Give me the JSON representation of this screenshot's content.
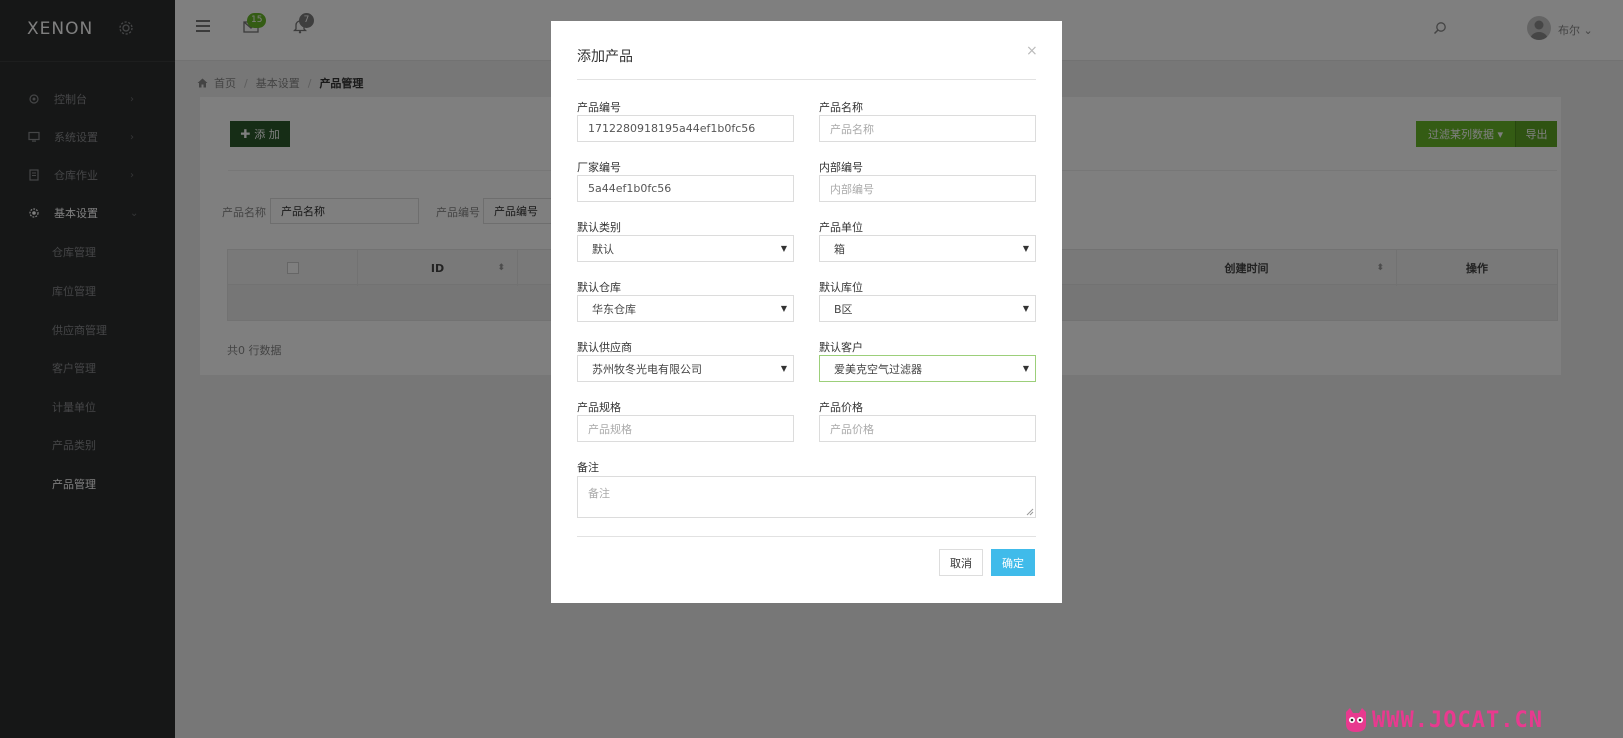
{
  "app": {
    "logo": "XENON"
  },
  "sidebar": {
    "items": [
      {
        "label": "控制台",
        "chevron": "›"
      },
      {
        "label": "系统设置",
        "chevron": "›"
      },
      {
        "label": "仓库作业",
        "chevron": "›"
      },
      {
        "label": "基本设置",
        "chevron": "⌄"
      }
    ],
    "subitems": [
      {
        "label": "仓库管理"
      },
      {
        "label": "库位管理"
      },
      {
        "label": "供应商管理"
      },
      {
        "label": "客户管理"
      },
      {
        "label": "计量单位"
      },
      {
        "label": "产品类别"
      },
      {
        "label": "产品管理"
      }
    ]
  },
  "header": {
    "mail_count": "15",
    "bell_count": "7",
    "user_name": "布尔 ⌄"
  },
  "breadcrumb": {
    "home": "首页",
    "level2": "基本设置",
    "current": "产品管理"
  },
  "panel": {
    "add_label": "添 加",
    "filter_label": "过滤某列数据 ▾",
    "export_label": "导出",
    "filters": {
      "name_label": "产品名称",
      "name_value": "产品名称",
      "code_label": "产品编号",
      "code_value": "产品编号"
    },
    "table": {
      "col_id": "ID",
      "col_created": "创建时间",
      "col_action": "操作",
      "sort_glyph": "⬍"
    },
    "footer": "共0 行数据"
  },
  "modal": {
    "title": "添加产品",
    "close": "×",
    "fields": {
      "product_code": {
        "label": "产品编号",
        "value": "1712280918195a44ef1b0fc56"
      },
      "product_name": {
        "label": "产品名称",
        "placeholder": "产品名称"
      },
      "factory_code": {
        "label": "厂家编号",
        "value": "5a44ef1b0fc56"
      },
      "internal_code": {
        "label": "内部编号",
        "placeholder": "内部编号"
      },
      "default_category": {
        "label": "默认类别",
        "value": "默认"
      },
      "product_unit": {
        "label": "产品单位",
        "value": "箱"
      },
      "default_warehouse": {
        "label": "默认仓库",
        "value": "华东仓库"
      },
      "default_location": {
        "label": "默认库位",
        "value": "B区"
      },
      "default_supplier": {
        "label": "默认供应商",
        "value": "苏州牧冬光电有限公司"
      },
      "default_customer": {
        "label": "默认客户",
        "value": "爱美克空气过滤器"
      },
      "spec": {
        "label": "产品规格",
        "placeholder": "产品规格"
      },
      "price": {
        "label": "产品价格",
        "placeholder": "产品价格"
      },
      "remark": {
        "label": "备注",
        "placeholder": "备注"
      }
    },
    "cancel_label": "取消",
    "ok_label": "确定"
  },
  "watermark": {
    "text": "WWW.JOCAT.CN"
  },
  "colors": {
    "sidebar": "#2c2e2f",
    "add_button": "#2c5a2c",
    "filter_button": "#68b828",
    "ok_button": "#40bbea",
    "watermark": "#e83a8f"
  }
}
